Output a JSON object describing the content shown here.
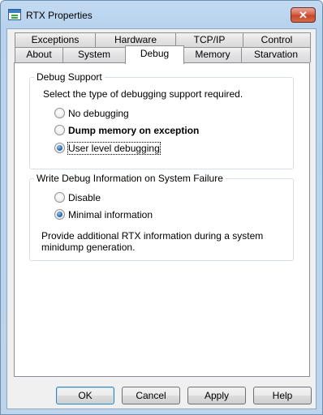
{
  "window": {
    "title": "RTX Properties",
    "close_glyph": "✕"
  },
  "tabs": {
    "row1": [
      "Exceptions",
      "Hardware",
      "TCP/IP",
      "Control"
    ],
    "row2": [
      "About",
      "System",
      "Debug",
      "Memory",
      "Starvation"
    ],
    "active": "Debug"
  },
  "debug_support": {
    "legend": "Debug Support",
    "prompt": "Select the type of debugging support required.",
    "options": [
      "No debugging",
      "Dump memory on exception",
      "User level debugging"
    ],
    "selected": "User level debugging"
  },
  "write_debug": {
    "legend": "Write Debug Information on System Failure",
    "options": [
      "Disable",
      "Minimal information"
    ],
    "selected": "Minimal information",
    "description_line1": "Provide additional RTX information during a system",
    "description_line2": "minidump generation."
  },
  "buttons": {
    "ok": "OK",
    "cancel": "Cancel",
    "apply": "Apply",
    "help": "Help"
  }
}
